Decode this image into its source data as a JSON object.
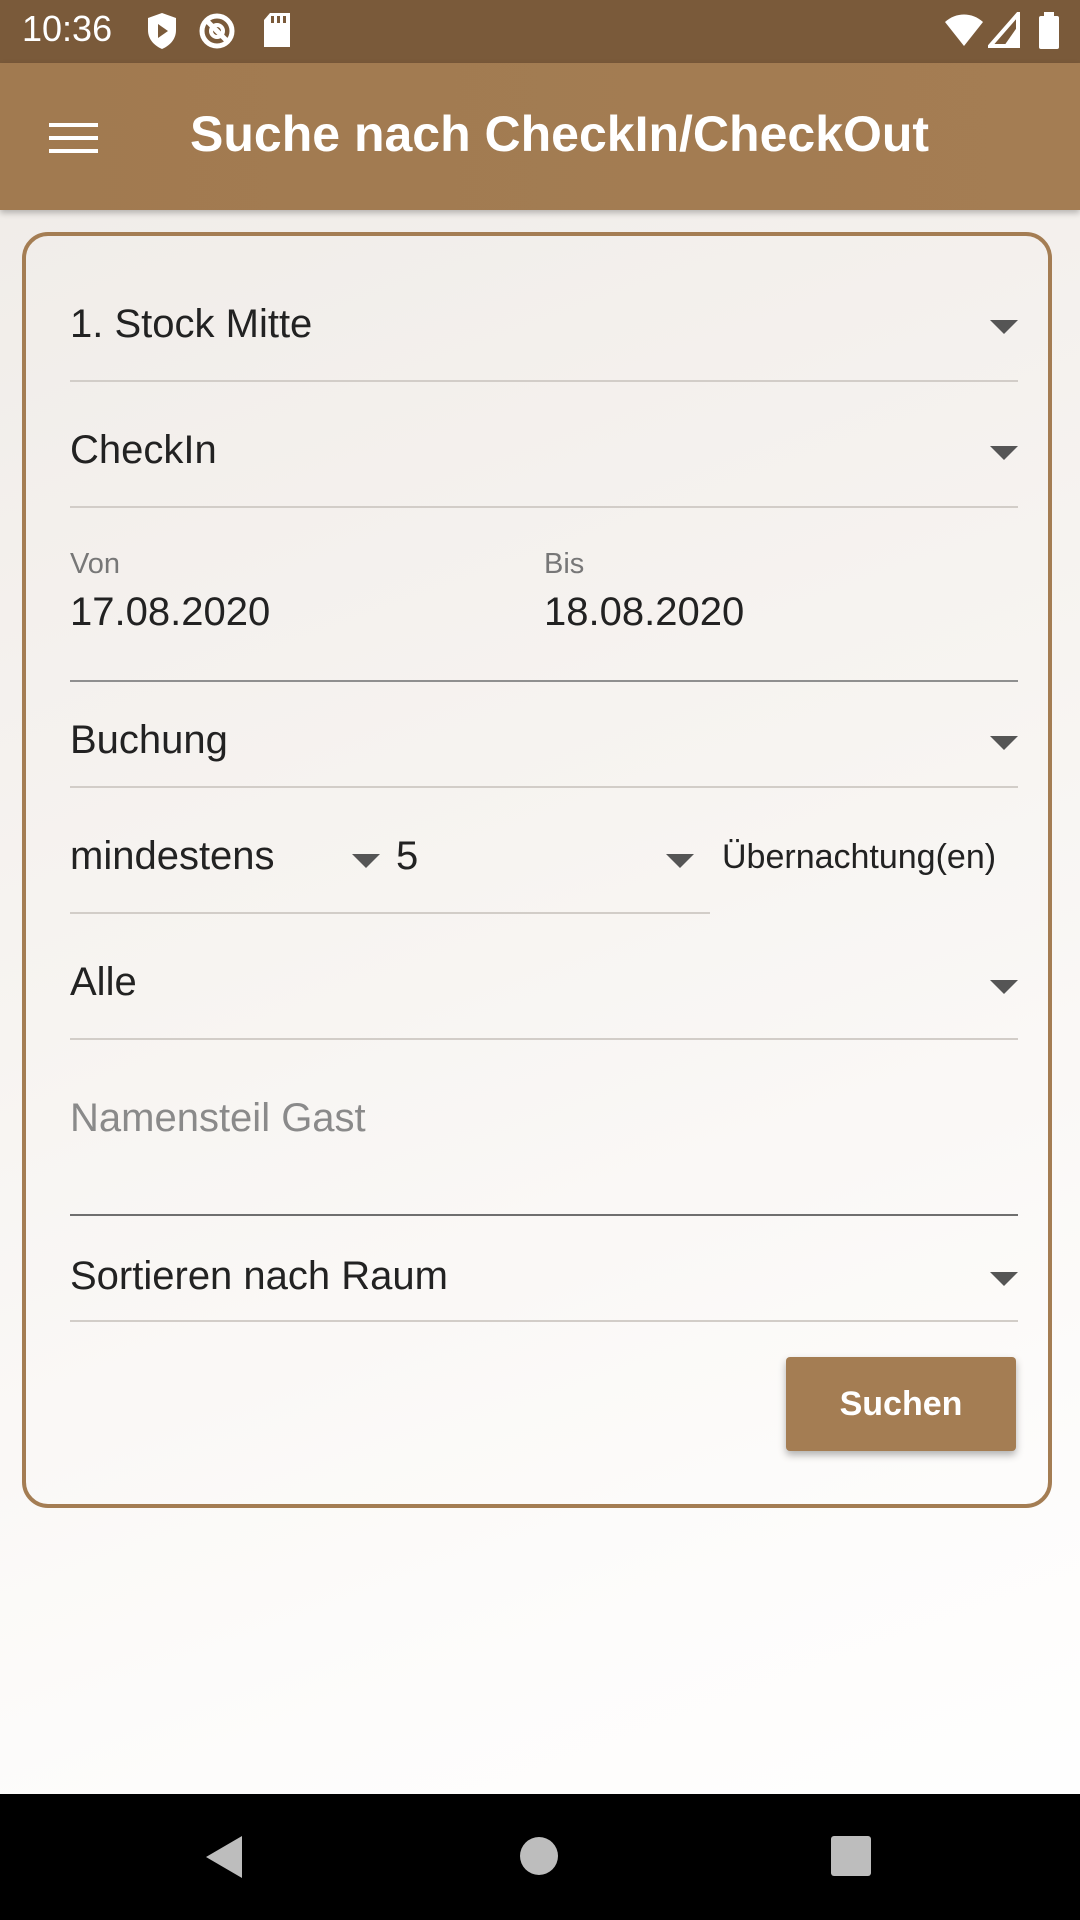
{
  "status_bar": {
    "time": "10:36",
    "left_icons": [
      "shield-play-icon",
      "at-sign-icon",
      "sd-card-icon"
    ],
    "right_icons": [
      "wifi-icon",
      "signal-icon",
      "battery-icon"
    ]
  },
  "app_bar": {
    "title": "Suche nach CheckIn/CheckOut",
    "menu_icon": "hamburger-menu-icon"
  },
  "form": {
    "location_select": "1. Stock Mitte",
    "type_select": "CheckIn",
    "date_from_label": "Von",
    "date_from_value": "17.08.2020",
    "date_to_label": "Bis",
    "date_to_value": "18.08.2020",
    "booking_select": "Buchung",
    "min_select": "mindestens",
    "nights_select": "5",
    "nights_suffix": "Übernachtung(en)",
    "filter_select": "Alle",
    "guest_name_placeholder": "Namensteil Gast",
    "sort_select": "Sortieren nach Raum",
    "search_button": "Suchen"
  },
  "colors": {
    "status_bar": "#7a5a3a",
    "app_bar": "#a47d53",
    "accent": "#a47d53",
    "nav_bar": "#000000"
  }
}
